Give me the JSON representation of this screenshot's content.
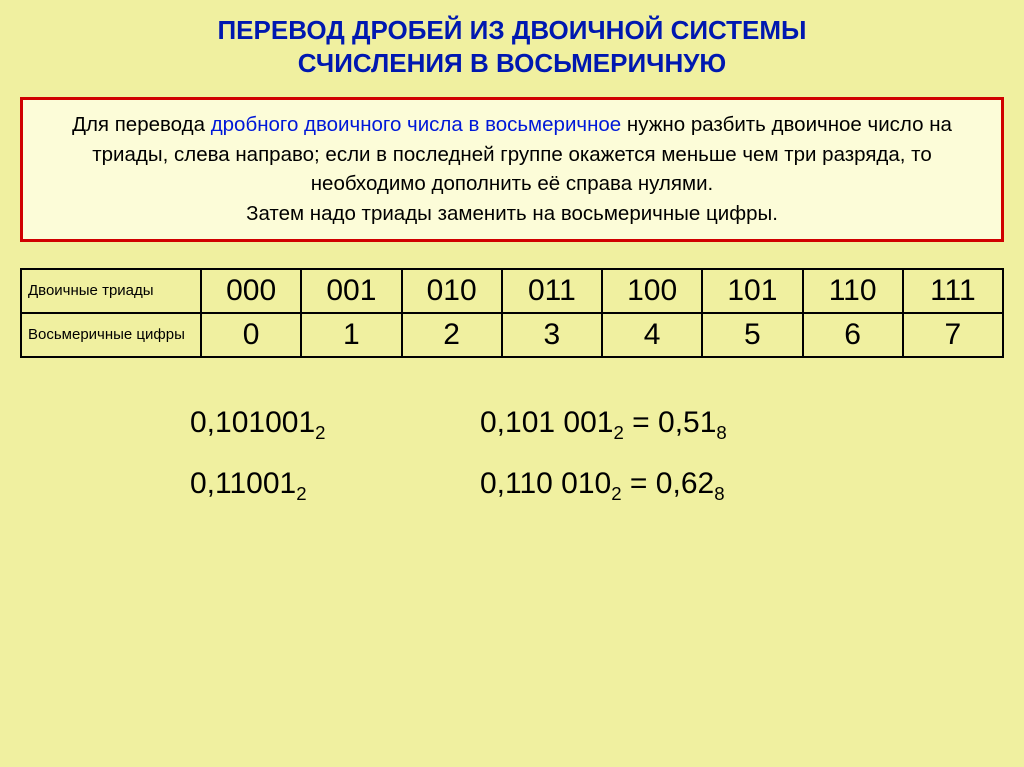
{
  "title_line1": "ПЕРЕВОД ДРОБЕЙ ИЗ ДВОИЧНОЙ СИСТЕМЫ",
  "title_line2": "СЧИСЛЕНИЯ В ВОСЬМЕРИЧНУЮ",
  "rule": {
    "pre": "Для перевода ",
    "blue": "дробного двоичного числа в восьмеричное",
    "post1": " нужно разбить двоичное число на триады, слева направо; если в последней группе окажется меньше чем три разряда, то необходимо дополнить её справа нулями.",
    "post2": "Затем надо триады заменить на восьмеричные цифры."
  },
  "table": {
    "row1_label": "Двоичные триады",
    "row2_label": "Восьмеричные цифры",
    "triads": [
      "000",
      "001",
      "010",
      "011",
      "100",
      "101",
      "110",
      "111"
    ],
    "digits": [
      "0",
      "1",
      "2",
      "3",
      "4",
      "5",
      "6",
      "7"
    ]
  },
  "ex": {
    "a_left": "0,101001",
    "a_sub_l": "2",
    "a_right": "0,101 001",
    "a_sub_r1": "2",
    "a_eq": " = ",
    "a_res": "0,51",
    "a_sub_r2": "8",
    "b_left": "0,11001",
    "b_sub_l": "2",
    "b_right": "0,110 010",
    "b_sub_r1": "2",
    "b_eq": " = ",
    "b_res": "0,62",
    "b_sub_r2": "8"
  }
}
